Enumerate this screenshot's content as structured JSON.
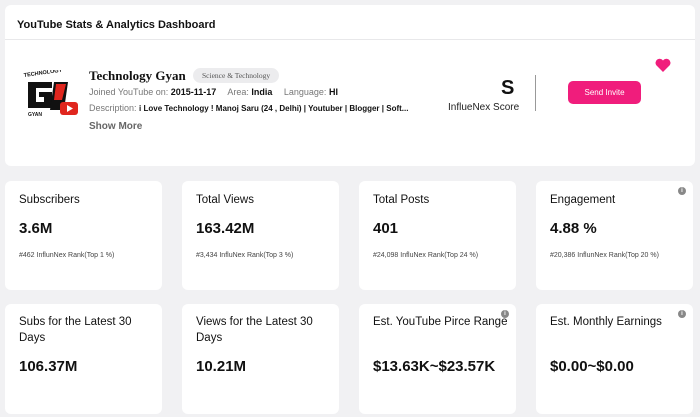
{
  "header": {
    "title": "YouTube Stats & Analytics Dashboard"
  },
  "channel": {
    "name": "Technology Gyan",
    "category": "Science & Technology",
    "joined_label": "Joined YouTube on:",
    "joined_value": "2015-11-17",
    "area_label": "Area:",
    "area_value": "India",
    "language_label": "Language:",
    "language_value": "HI",
    "description_label": "Description:",
    "description_value": "i Love Technology ! Manoj Saru (24 , Delhi) | Youtuber | Blogger | Soft...",
    "show_more": "Show More",
    "logo_top_text": "TECHNOLOGY",
    "logo_bottom_text": "GYAN"
  },
  "score": {
    "letter": "S",
    "label": "InflueNex Score"
  },
  "actions": {
    "invite_label": "Send Invite"
  },
  "stats": [
    {
      "label": "Subscribers",
      "value": "3.6M",
      "rank": "#462 InflunNex Rank(Top 1 %)"
    },
    {
      "label": "Total Views",
      "value": "163.42M",
      "rank": "#3,434 InfluNex Rank(Top 3 %)"
    },
    {
      "label": "Total Posts",
      "value": "401",
      "rank": "#24,098 InfluNex Rank(Top 24 %)"
    },
    {
      "label": "Engagement",
      "value": "4.88 %",
      "rank": "#20,386 InflunNex Rank(Top 20 %)"
    },
    {
      "label": "Subs for the Latest 30 Days",
      "value": "106.37M"
    },
    {
      "label": "Views for the Latest 30 Days",
      "value": "10.21M"
    },
    {
      "label": "Est. YouTube Pirce Range",
      "value": "$13.63K~$23.57K"
    },
    {
      "label": "Est. Monthly Earnings",
      "value": "$0.00~$0.00"
    }
  ],
  "icons": {
    "info": "i"
  },
  "colors": {
    "accent": "#f01d7c",
    "logo_red": "#e0261e",
    "background": "#f1f1f3"
  }
}
